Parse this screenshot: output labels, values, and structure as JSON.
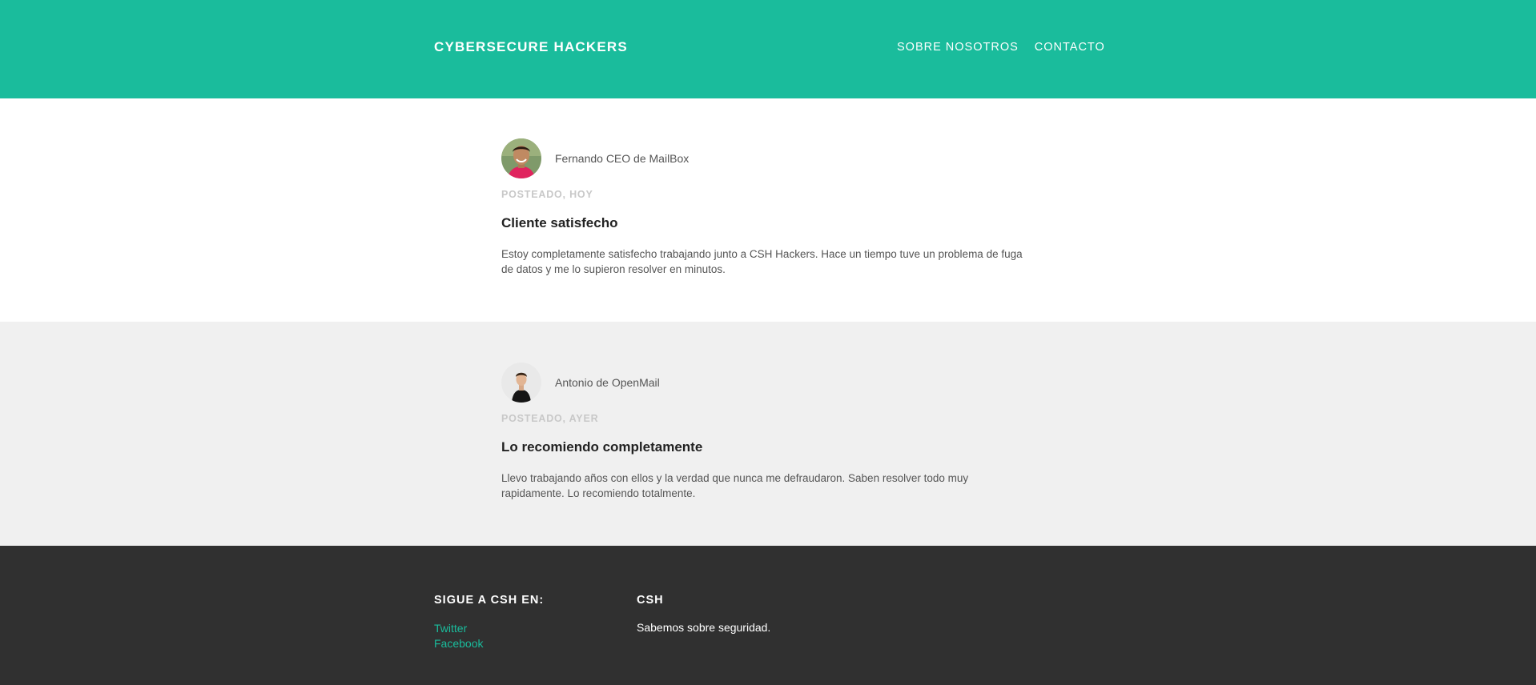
{
  "header": {
    "brand": "CYBERSECURE HACKERS",
    "nav": [
      "SOBRE NOSOTROS",
      "CONTACTO"
    ],
    "background_color": "#1abc9c"
  },
  "posts": [
    {
      "author": "Fernando CEO de MailBox",
      "avatar_icon": "person-avatar",
      "posted": "POSTEADO, HOY",
      "title": "Cliente satisfecho",
      "text": "Estoy completamente satisfecho trabajando junto a CSH Hackers. Hace un tiempo tuve un problema de fuga de datos y me lo supieron resolver en minutos."
    },
    {
      "author": "Antonio de OpenMail",
      "avatar_icon": "person-avatar",
      "posted": "POSTEADO, AYER",
      "title": "Lo recomiendo completamente",
      "text": "Llevo trabajando años con ellos y la verdad que nunca me defraudaron. Saben resolver todo muy rapidamente. Lo recomiendo totalmente."
    }
  ],
  "footer": {
    "follow_title": "SIGUE A CSH EN:",
    "links": [
      "Twitter",
      "Facebook"
    ],
    "about_title": "CSH",
    "about_text": "Sabemos sobre seguridad.",
    "background_color": "#303030",
    "link_color": "#1abc9c"
  }
}
